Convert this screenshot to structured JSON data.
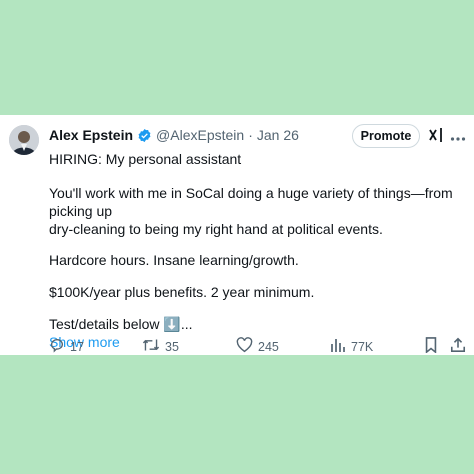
{
  "tweet": {
    "author_name": "Alex Epstein",
    "handle": "@AlexEpstein",
    "separator": "·",
    "date": "Jan 26",
    "promote_label": "Promote",
    "lines": [
      "HIRING: My personal assistant",
      "You'll work with me in SoCal doing a huge variety of things—from picking up",
      "dry-cleaning to being my right hand at political events.",
      "Hardcore hours. Insane learning/growth.",
      "$100K/year plus benefits. 2 year minimum.",
      "Test/details below ⬇️..."
    ],
    "show_more": "Show more"
  },
  "actions": {
    "replies": "17",
    "reposts": "35",
    "likes": "245",
    "views": "77K"
  },
  "icons": {
    "verified": "verified-badge-icon",
    "grok": "grok-icon",
    "more": "more-options-icon",
    "reply": "reply-icon",
    "repost": "repost-icon",
    "like": "heart-icon",
    "views": "views-icon",
    "bookmark": "bookmark-icon",
    "share": "share-icon"
  },
  "colors": {
    "background": "#b3e5c0",
    "card": "#ffffff",
    "text": "#0f1419",
    "muted": "#536471",
    "link": "#1d9bf0"
  }
}
